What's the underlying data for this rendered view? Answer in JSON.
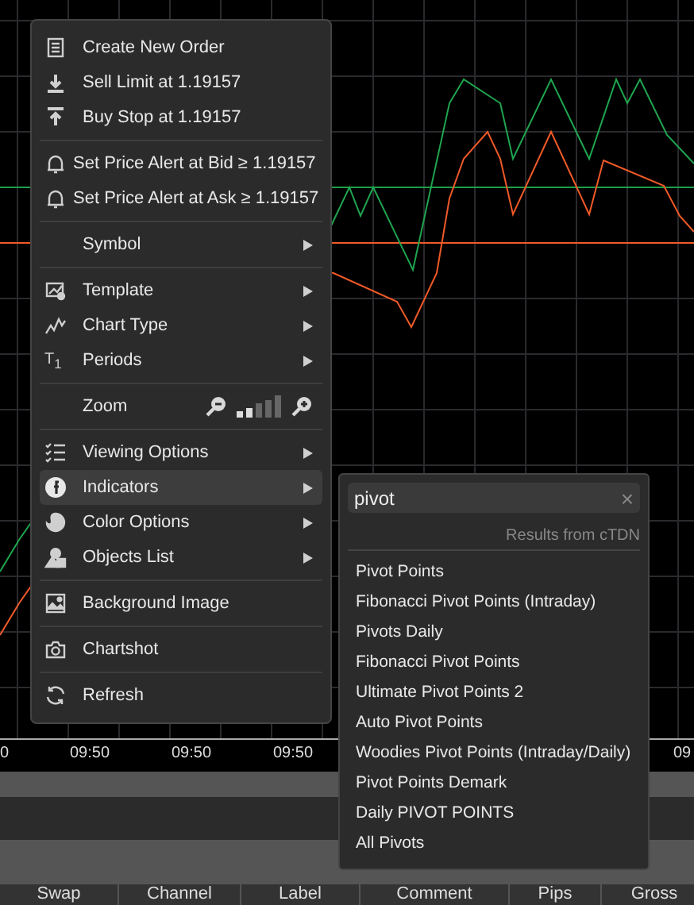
{
  "chart": {
    "time_labels": [
      "0",
      "09:50",
      "09:50",
      "09:50",
      "09"
    ]
  },
  "context_menu": {
    "sections": [
      {
        "items": [
          {
            "label": "Create New Order",
            "kind": "action",
            "selected": false
          },
          {
            "label": "Sell Limit at 1.19157",
            "kind": "action",
            "selected": false
          },
          {
            "label": "Buy Stop at 1.19157",
            "kind": "action",
            "selected": false
          }
        ]
      },
      {
        "items": [
          {
            "label": "Set Price Alert at Bid ≥ 1.19157",
            "kind": "action",
            "selected": false
          },
          {
            "label": "Set Price Alert at Ask ≥ 1.19157",
            "kind": "action",
            "selected": false
          }
        ]
      },
      {
        "items": [
          {
            "label": "Symbol",
            "kind": "submenu",
            "selected": false
          }
        ]
      },
      {
        "items": [
          {
            "label": "Template",
            "kind": "submenu",
            "selected": false
          },
          {
            "label": "Chart Type",
            "kind": "submenu",
            "selected": false
          },
          {
            "label": "Periods",
            "kind": "submenu",
            "selected": false,
            "icon_text": "T$_{1}$"
          }
        ]
      },
      {
        "items": [
          {
            "label": "Zoom",
            "kind": "zoom",
            "selected": false,
            "level": 0.4
          }
        ]
      },
      {
        "items": [
          {
            "label": "Viewing Options",
            "kind": "submenu",
            "selected": false
          },
          {
            "label": "Indicators",
            "kind": "submenu",
            "selected": true
          },
          {
            "label": "Color Options",
            "kind": "submenu",
            "selected": false
          },
          {
            "label": "Objects List",
            "kind": "submenu",
            "selected": false
          }
        ]
      },
      {
        "items": [
          {
            "label": "Background Image",
            "kind": "action",
            "selected": false
          }
        ]
      },
      {
        "items": [
          {
            "label": "Chartshot",
            "kind": "action",
            "selected": false
          }
        ]
      },
      {
        "items": [
          {
            "label": "Refresh",
            "kind": "action",
            "selected": false
          }
        ]
      }
    ]
  },
  "indicator_search": {
    "value": "pivot",
    "clear": "×",
    "source_note": "Results from cTDN",
    "results": [
      "Pivot Points",
      "Fibonacci Pivot Points (Intraday)",
      "Pivots Daily",
      "Fibonacci Pivot Points",
      "Ultimate Pivot Points 2",
      "Auto Pivot Points",
      "Woodies Pivot Points (Intraday/Daily)",
      "Pivot Points Demark",
      "Daily PIVOT POINTS",
      "All Pivots"
    ]
  },
  "table": {
    "columns": [
      "Swap",
      "Channel",
      "Label",
      "Comment",
      "Pips",
      "Gross"
    ]
  }
}
